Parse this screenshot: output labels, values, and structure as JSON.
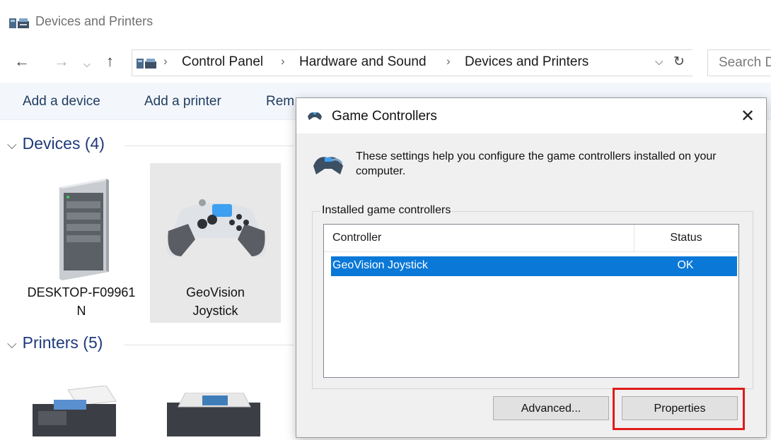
{
  "window": {
    "title": "Devices and Printers",
    "icon": "devices-printers-icon"
  },
  "nav": {
    "back_icon": "back-arrow-icon",
    "forward_icon": "forward-arrow-icon",
    "recent_icon": "chevron-down-icon",
    "up_icon": "up-arrow-icon",
    "breadcrumb": [
      "Control Panel",
      "Hardware and Sound",
      "Devices and Printers"
    ],
    "separator": "›",
    "search_placeholder": "Search D"
  },
  "commands": [
    "Add a device",
    "Add a printer",
    "Rem"
  ],
  "groups": {
    "devices": {
      "label": "Devices (4)"
    },
    "printers": {
      "label": "Printers (5)"
    }
  },
  "devices": [
    {
      "line1": "DESKTOP-F09961",
      "line2": "N",
      "icon": "desktop-computer-icon"
    },
    {
      "line1": "GeoVision",
      "line2": "Joystick",
      "icon": "gamepad-icon"
    }
  ],
  "printers": [
    {
      "icon": "fax-printer-icon"
    },
    {
      "icon": "printer-icon"
    }
  ],
  "dialog": {
    "title": "Game Controllers",
    "close_glyph": "✕",
    "info_text": "These settings help you configure the game controllers installed on your computer.",
    "group_label": "Installed game controllers",
    "columns": {
      "controller": "Controller",
      "status": "Status"
    },
    "rows": [
      {
        "controller": "GeoVision Joystick",
        "status": "OK"
      }
    ],
    "buttons": {
      "advanced": "Advanced...",
      "properties": "Properties"
    }
  },
  "colors": {
    "selection": "#0a78d7",
    "highlight_box": "#e01b1b",
    "link": "#1e3a7b"
  }
}
